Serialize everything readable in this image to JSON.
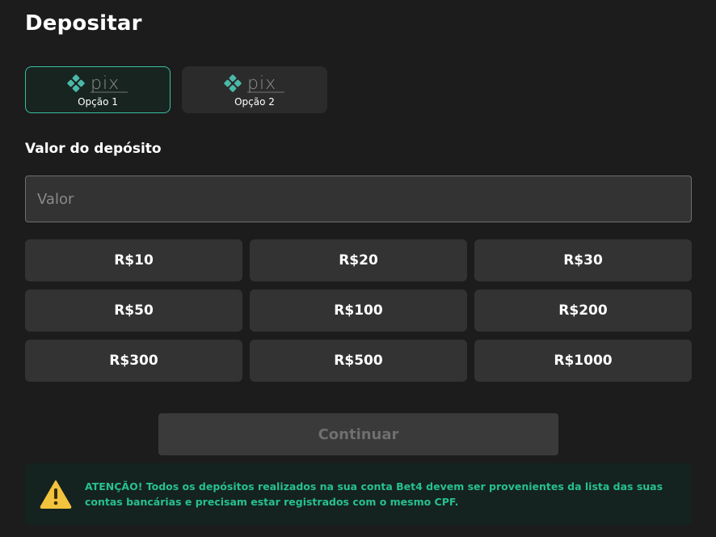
{
  "page": {
    "title": "Depositar"
  },
  "payment_methods": [
    {
      "logo_text": "pix",
      "label": "Opção 1",
      "selected": true
    },
    {
      "logo_text": "pix",
      "label": "Opção 2",
      "selected": false
    }
  ],
  "deposit": {
    "section_label": "Valor do depósito",
    "input_value": "",
    "input_placeholder": "Valor"
  },
  "amount_options": [
    "R$10",
    "R$20",
    "R$30",
    "R$50",
    "R$100",
    "R$200",
    "R$300",
    "R$500",
    "R$1000"
  ],
  "continue_label": "Continuar",
  "notice": {
    "icon": "warning-icon",
    "text": "ATENÇÃO! Todos os depósitos realizados na sua conta Bet4 devem ser provenientes da lista das suas contas bancárias e precisam estar registrados com o mesmo CPF."
  },
  "colors": {
    "background": "#1c1c1c",
    "selected_border": "#3bbfa2",
    "pix_teal": "#4bb8a9",
    "notice_text": "#27c08e",
    "warning_yellow": "#f2c33c"
  }
}
